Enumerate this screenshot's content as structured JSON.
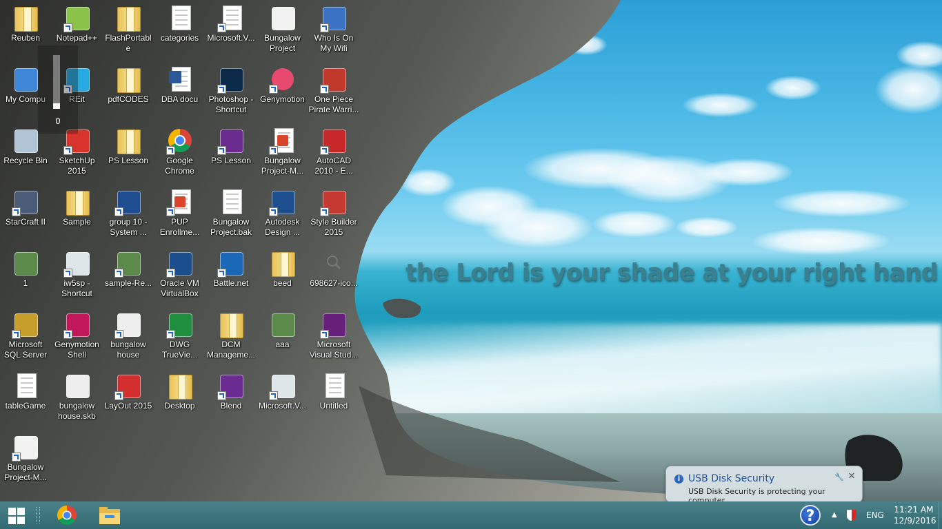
{
  "wallpaper": {
    "verse": "the Lord is your shade at your right hand"
  },
  "desktop": {
    "icons": [
      {
        "label": "Reuben",
        "icon": "user-folder-icon"
      },
      {
        "label": "Notepad++",
        "icon": "notepad-plus-plus-icon"
      },
      {
        "label": "FlashPortable",
        "icon": "folder-icon"
      },
      {
        "label": "categories",
        "icon": "text-document-icon"
      },
      {
        "label": "Microsoft.V...",
        "icon": "document-icon"
      },
      {
        "label": "Bungalow Project",
        "icon": "sketch-thumbnail-icon"
      },
      {
        "label": "Who Is On My Wifi",
        "icon": "who-is-on-my-wifi-icon"
      },
      {
        "label": "My Compu",
        "icon": "computer-icon"
      },
      {
        "label": "REit",
        "icon": "reit-app-icon"
      },
      {
        "label": "pdfCODES",
        "icon": "folder-icon"
      },
      {
        "label": "DBA docu",
        "icon": "word-document-icon"
      },
      {
        "label": "Photoshop - Shortcut",
        "icon": "photoshop-icon"
      },
      {
        "label": "Genymotion",
        "icon": "genymotion-icon"
      },
      {
        "label": "One Piece Pirate Warri...",
        "icon": "one-piece-game-icon"
      },
      {
        "label": "Recycle Bin",
        "icon": "recycle-bin-icon"
      },
      {
        "label": "SketchUp 2015",
        "icon": "sketchup-icon"
      },
      {
        "label": "PS Lesson",
        "icon": "folder-icon"
      },
      {
        "label": "Google Chrome",
        "icon": "chrome-icon"
      },
      {
        "label": "PS Lesson",
        "icon": "winrar-archive-icon"
      },
      {
        "label": "Bungalow Project-M...",
        "icon": "pdf-document-icon"
      },
      {
        "label": "AutoCAD 2010 - E...",
        "icon": "autocad-icon"
      },
      {
        "label": "StarCraft II",
        "icon": "starcraft-icon"
      },
      {
        "label": "Sample",
        "icon": "folder-icon"
      },
      {
        "label": "group 10 - System ...",
        "icon": "presentation-thumbnail-icon"
      },
      {
        "label": "PUP Enrollme...",
        "icon": "pdf-document-icon"
      },
      {
        "label": "Bungalow Project.bak",
        "icon": "blank-file-icon"
      },
      {
        "label": "Autodesk Design ...",
        "icon": "autodesk-revit-icon"
      },
      {
        "label": "Style Builder 2015",
        "icon": "style-builder-icon"
      },
      {
        "label": "1",
        "icon": "image-thumbnail-icon"
      },
      {
        "label": "iw5sp - Shortcut",
        "icon": "game-window-icon"
      },
      {
        "label": "sample-Re...",
        "icon": "image-thumbnail-icon"
      },
      {
        "label": "Oracle VM VirtualBox",
        "icon": "virtualbox-icon"
      },
      {
        "label": "Battle.net",
        "icon": "battle-net-icon"
      },
      {
        "label": "beed",
        "icon": "folder-icon"
      },
      {
        "label": "698627-ico...",
        "icon": "magnifier-image-icon"
      },
      {
        "label": "Microsoft SQL Server ...",
        "icon": "sql-server-tools-icon"
      },
      {
        "label": "Genymotion Shell",
        "icon": "genymotion-shell-icon"
      },
      {
        "label": "bungalow house",
        "icon": "house-thumbnail-icon"
      },
      {
        "label": "DWG TrueVie...",
        "icon": "dwg-trueview-icon"
      },
      {
        "label": "DCM Manageme...",
        "icon": "folder-icon"
      },
      {
        "label": "aaa",
        "icon": "image-thumbnail-icon"
      },
      {
        "label": "Microsoft Visual Stud...",
        "icon": "visual-studio-icon"
      },
      {
        "label": "tableGame",
        "icon": "text-document-icon"
      },
      {
        "label": "bungalow house.skb",
        "icon": "house-thumbnail-icon"
      },
      {
        "label": "LayOut 2015",
        "icon": "layout-icon"
      },
      {
        "label": "Desktop",
        "icon": "folder-icon"
      },
      {
        "label": "Blend",
        "icon": "blend-icon"
      },
      {
        "label": "Microsoft.V...",
        "icon": "game-window-icon"
      },
      {
        "label": "Untitled",
        "icon": "untitled-document-icon"
      },
      {
        "label": "Bungalow Project-M...",
        "icon": "sketch-thumbnail-icon"
      }
    ]
  },
  "volume_popup": {
    "value": "0",
    "level": 0.1
  },
  "notification": {
    "title": "USB Disk Security",
    "body": "USB Disk Security is protecting your computer",
    "info_glyph": "i",
    "close_glyph": "✕",
    "settings_glyph": "🔧"
  },
  "taskbar": {
    "pinned": [
      "chrome-icon",
      "file-explorer-icon"
    ],
    "tray": {
      "help_glyph": "?",
      "arrow_glyph": "▲",
      "language": "ENG",
      "time": "11:21 AM",
      "date": "12/9/2016"
    }
  }
}
